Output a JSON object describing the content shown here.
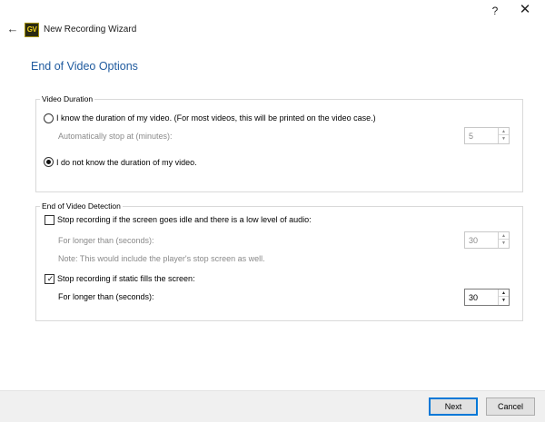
{
  "window": {
    "title": "New Recording Wizard",
    "logo_text": "GV",
    "help_glyph": "?",
    "close_glyph": "✕",
    "back_glyph": "←"
  },
  "page": {
    "title": "End of Video Options"
  },
  "video_duration": {
    "group_label": "Video Duration",
    "option_known": {
      "label": "I know the duration of my video. (For most videos, this will be printed on the video case.)",
      "selected": false
    },
    "auto_stop": {
      "label": "Automatically stop at (minutes):",
      "value": "5",
      "enabled": false
    },
    "option_unknown": {
      "label": "I do not know the duration of my video.",
      "selected": true
    }
  },
  "end_detection": {
    "group_label": "End of Video Detection",
    "idle_audio": {
      "label": "Stop recording if the screen goes idle and there is a low level of audio:",
      "checked": false,
      "duration_label": "For longer than (seconds):",
      "duration_value": "30",
      "note": "Note: This would include the player's stop screen as well."
    },
    "static": {
      "label": "Stop recording if static fills the screen:",
      "checked": true,
      "duration_label": "For longer than (seconds):",
      "duration_value": "30"
    }
  },
  "spinner": {
    "up_glyph": "▲",
    "down_glyph": "▼"
  },
  "checkbox": {
    "check_glyph": "✓"
  },
  "footer": {
    "next_label": "Next",
    "cancel_label": "Cancel"
  },
  "colors": {
    "title_blue": "#1f5a9e",
    "disabled_text": "#8a8a8a",
    "primary_button_border": "#0078d7",
    "footer_bg": "#f0f0f0"
  }
}
